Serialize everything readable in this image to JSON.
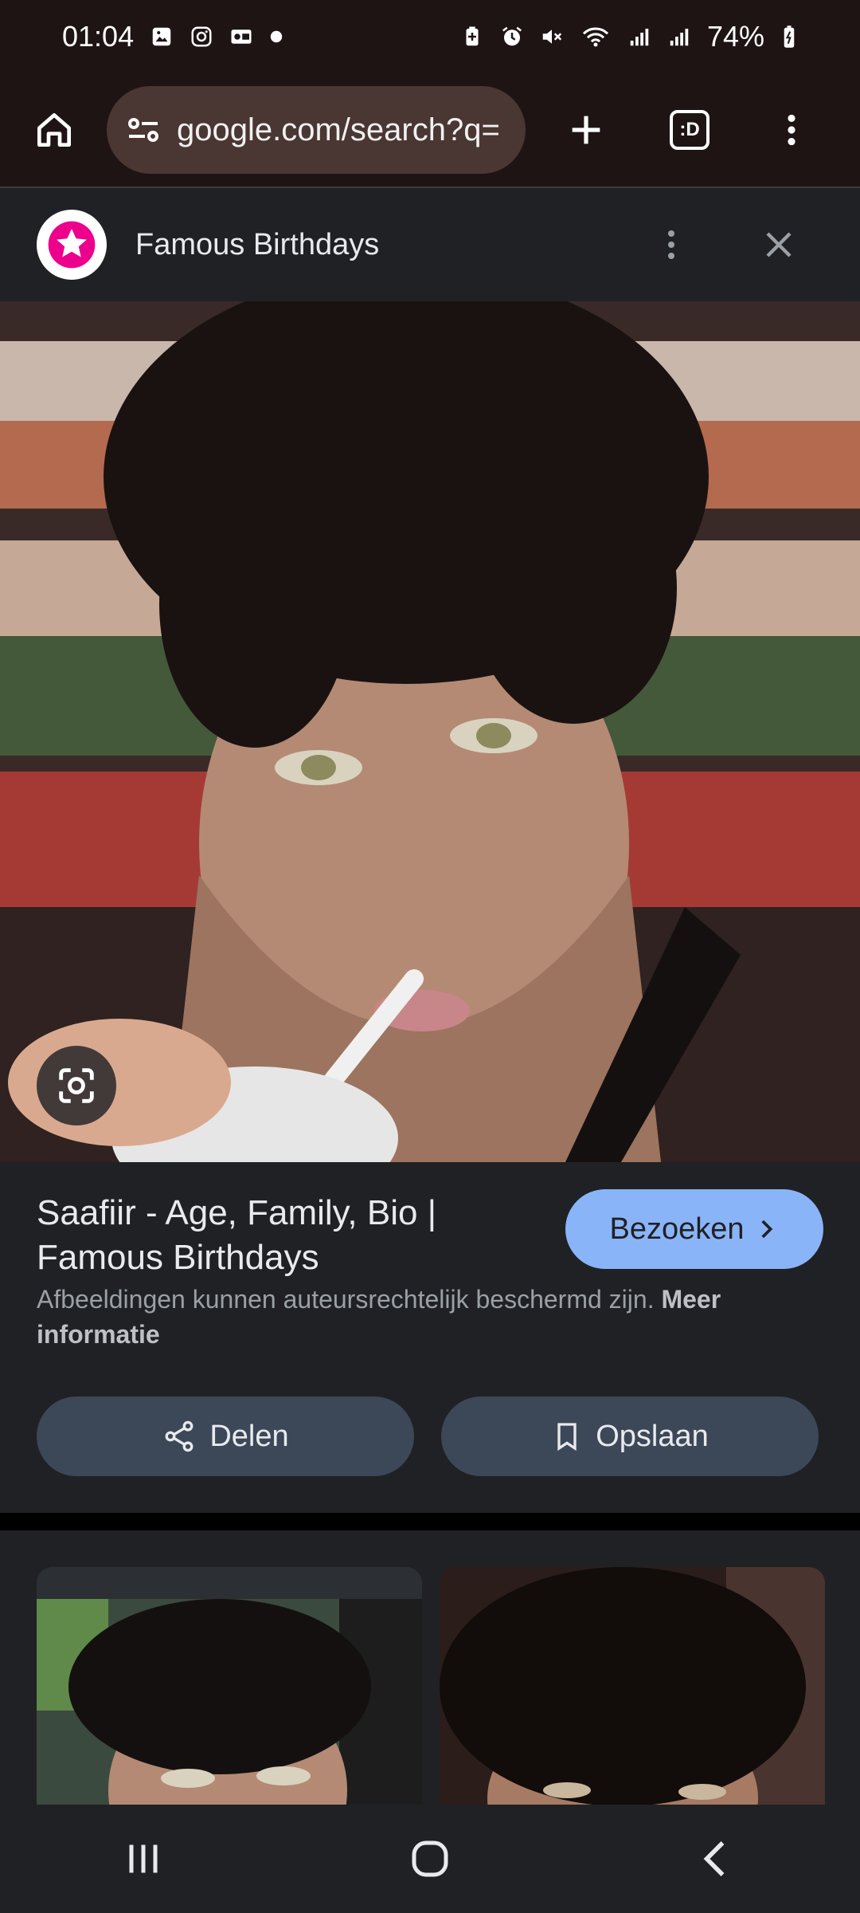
{
  "status": {
    "time": "01:04",
    "battery": "74%"
  },
  "browser": {
    "url": "google.com/search?q=",
    "tab_label": ":D"
  },
  "result": {
    "site_name": "Famous Birthdays",
    "title": "Saafiir - Age, Family, Bio | Famous Birthdays",
    "visit_label": "Bezoeken",
    "copyright_text": "Afbeeldingen kunnen auteursrechtelijk beschermd zijn.",
    "more_info_label": "Meer informatie",
    "share_label": "Delen",
    "save_label": "Opslaan"
  },
  "colors": {
    "browser_bar": "#1f1414",
    "omnibox": "#4a3632",
    "accent_blue": "#8ab4f8",
    "action_button": "#3c4858",
    "brand_pink": "#ec008c"
  },
  "icons": {
    "status": [
      "gallery-icon",
      "instagram-icon",
      "outlook-icon",
      "dot-icon",
      "battery-saver-icon",
      "alarm-icon",
      "mute-icon",
      "wifi-icon",
      "signal-icon",
      "signal-icon",
      "battery-icon"
    ],
    "browser": [
      "home-icon",
      "site-info-icon",
      "new-tab-icon",
      "tab-switcher-icon",
      "more-vert-icon"
    ],
    "panel": [
      "famous-birthdays-logo",
      "more-vert-icon",
      "close-icon",
      "lens-icon",
      "chevron-right-icon",
      "share-icon",
      "bookmark-icon"
    ],
    "nav": [
      "recent-apps-icon",
      "home-button-icon",
      "back-icon"
    ]
  }
}
